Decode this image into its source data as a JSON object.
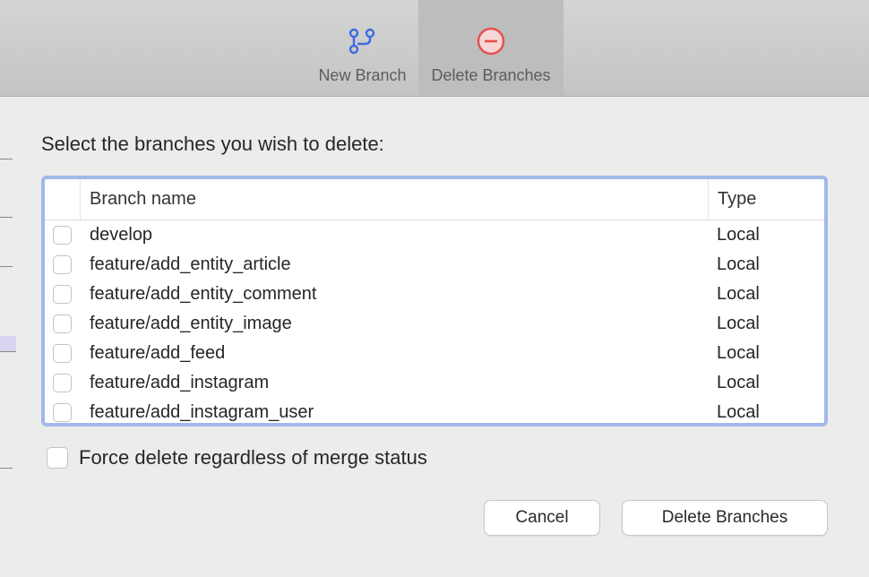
{
  "toolbar": {
    "tabs": [
      {
        "id": "new-branch",
        "label": "New Branch",
        "icon": "branch-icon",
        "active": false
      },
      {
        "id": "delete-branches",
        "label": "Delete Branches",
        "icon": "minus-circle-icon",
        "active": true
      }
    ]
  },
  "instruction": "Select the branches you wish to delete:",
  "columns": {
    "name": "Branch name",
    "type": "Type"
  },
  "branches": [
    {
      "name": "develop",
      "type": "Local",
      "checked": false
    },
    {
      "name": "feature/add_entity_article",
      "type": "Local",
      "checked": false
    },
    {
      "name": "feature/add_entity_comment",
      "type": "Local",
      "checked": false
    },
    {
      "name": "feature/add_entity_image",
      "type": "Local",
      "checked": false
    },
    {
      "name": "feature/add_feed",
      "type": "Local",
      "checked": false
    },
    {
      "name": "feature/add_instagram",
      "type": "Local",
      "checked": false
    },
    {
      "name": "feature/add_instagram_user",
      "type": "Local",
      "checked": false
    }
  ],
  "force_delete": {
    "label": "Force delete regardless of merge status",
    "checked": false
  },
  "buttons": {
    "cancel": "Cancel",
    "delete": "Delete Branches"
  },
  "icons": {
    "branch_color": "#3e6ae1",
    "delete_stroke": "#e55050",
    "delete_fill": "#f7d6d6"
  }
}
